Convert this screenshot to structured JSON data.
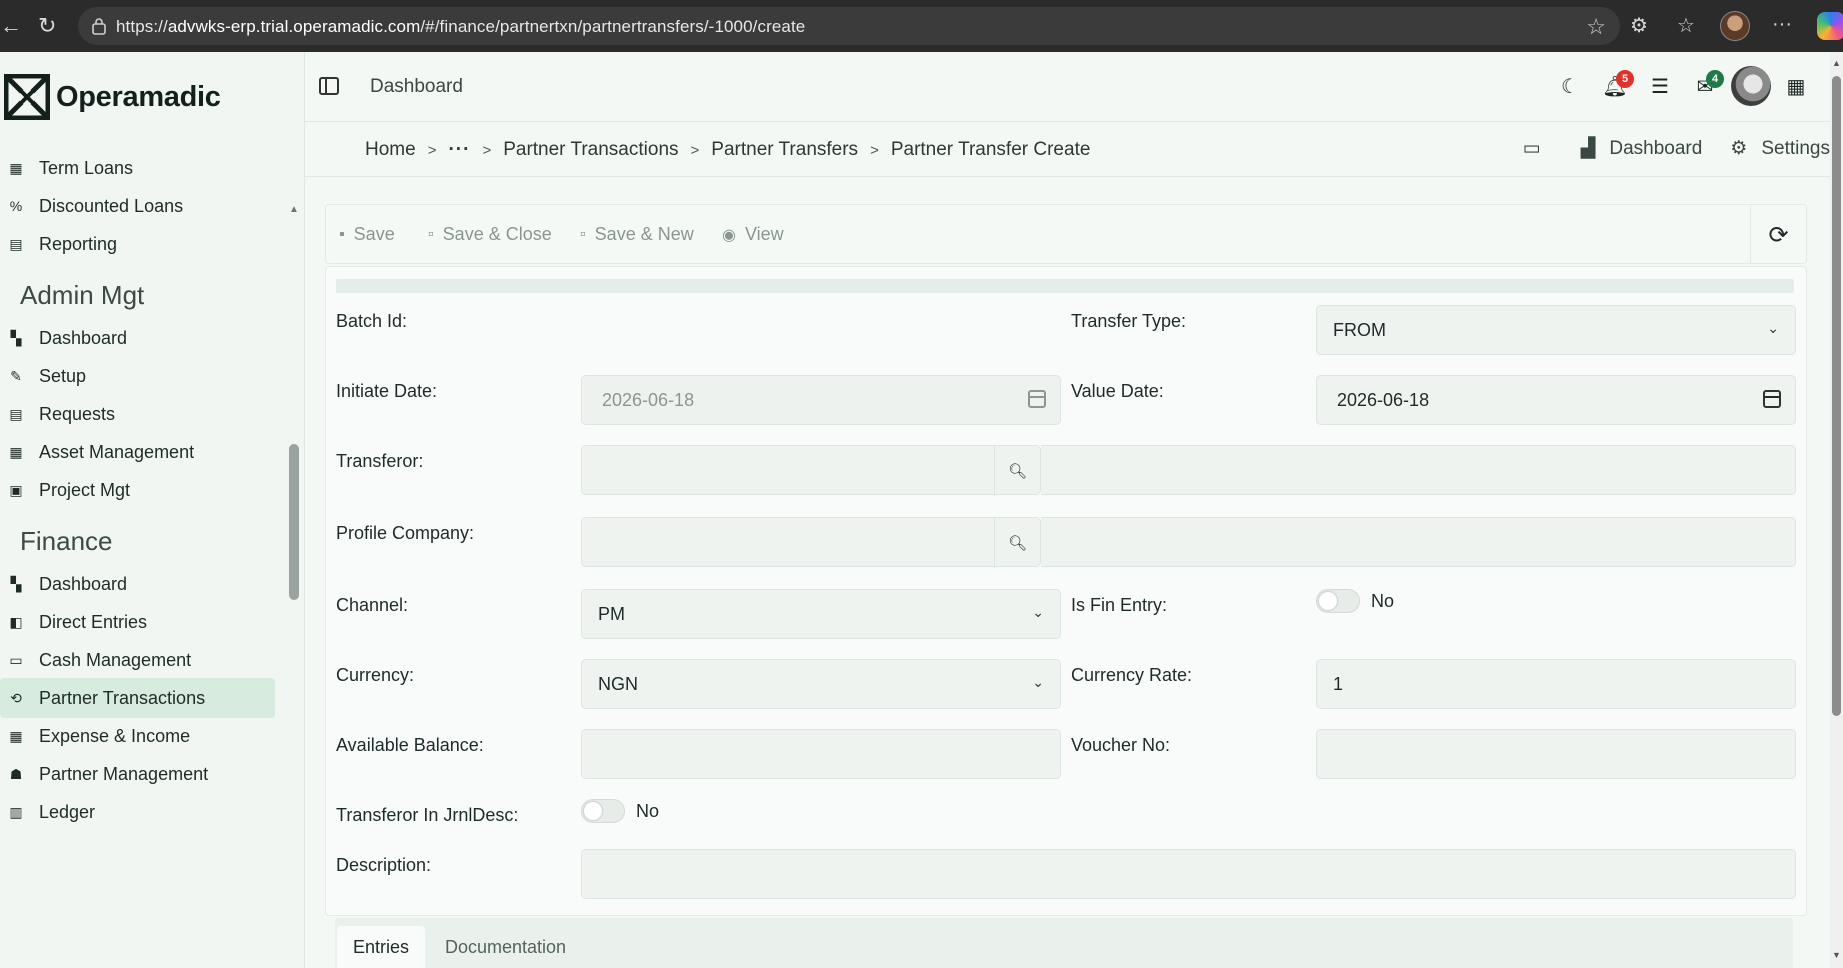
{
  "browser": {
    "url_prefix": "https://",
    "url_host": "advwks-erp.trial.operamadic.com",
    "url_path": "/#/finance/partnertxn/partnertransfers/-1000/create"
  },
  "app": {
    "logo_text": "Operamadic",
    "topbar_title": "Dashboard",
    "notifications_count": "5",
    "mail_count": "4"
  },
  "sidebar": {
    "items_top": [
      {
        "label": "Term Loans",
        "icon": "calendar-icon"
      },
      {
        "label": "Discounted Loans",
        "icon": "percent-icon"
      },
      {
        "label": "Reporting",
        "icon": "report-icon"
      }
    ],
    "admin_title": "Admin Mgt",
    "admin_items": [
      {
        "label": "Dashboard",
        "icon": "dashboard-icon"
      },
      {
        "label": "Setup",
        "icon": "wrench-icon"
      },
      {
        "label": "Requests",
        "icon": "requests-icon"
      },
      {
        "label": "Asset Management",
        "icon": "asset-icon"
      },
      {
        "label": "Project Mgt",
        "icon": "project-icon"
      }
    ],
    "finance_title": "Finance",
    "finance_items": [
      {
        "label": "Dashboard",
        "icon": "dashboard-icon"
      },
      {
        "label": "Direct Entries",
        "icon": "direct-entries-icon"
      },
      {
        "label": "Cash Management",
        "icon": "cash-icon"
      },
      {
        "label": "Partner Transactions",
        "icon": "partner-transactions-icon"
      },
      {
        "label": "Expense & Income",
        "icon": "calculator-icon"
      },
      {
        "label": "Partner Management",
        "icon": "people-icon"
      },
      {
        "label": "Ledger",
        "icon": "ledger-icon"
      }
    ]
  },
  "breadcrumb": {
    "items": [
      "Home",
      "Partner Transactions",
      "Partner Transfers",
      "Partner Transfer Create"
    ],
    "ellipsis": "···",
    "actions": {
      "dashboard": "Dashboard",
      "settings": "Settings"
    }
  },
  "toolbar": {
    "save": "Save",
    "save_close": "Save & Close",
    "save_new": "Save & New",
    "view": "View"
  },
  "form": {
    "batch_id_label": "Batch Id:",
    "transfer_type_label": "Transfer Type:",
    "transfer_type_value": "FROM",
    "initiate_date_label": "Initiate Date:",
    "initiate_date_value": "2026-06-18",
    "value_date_label": "Value Date:",
    "value_date_value": "2026-06-18",
    "transferor_label": "Transferor:",
    "profile_company_label": "Profile Company:",
    "channel_label": "Channel:",
    "channel_value": "PM",
    "is_fin_entry_label": "Is Fin Entry:",
    "is_fin_entry_value": "No",
    "currency_label": "Currency:",
    "currency_value": "NGN",
    "currency_rate_label": "Currency Rate:",
    "currency_rate_value": "1",
    "available_balance_label": "Available Balance:",
    "voucher_no_label": "Voucher No:",
    "transferor_in_jrnl_label": "Transferor In JrnlDesc:",
    "transferor_in_jrnl_value": "No",
    "description_label": "Description:"
  },
  "tabs": {
    "entries": "Entries",
    "documentation": "Documentation"
  },
  "colors": {
    "active_menu": "#d7ecdf",
    "badge_red": "#e2312a",
    "badge_green": "#1f7a47"
  }
}
